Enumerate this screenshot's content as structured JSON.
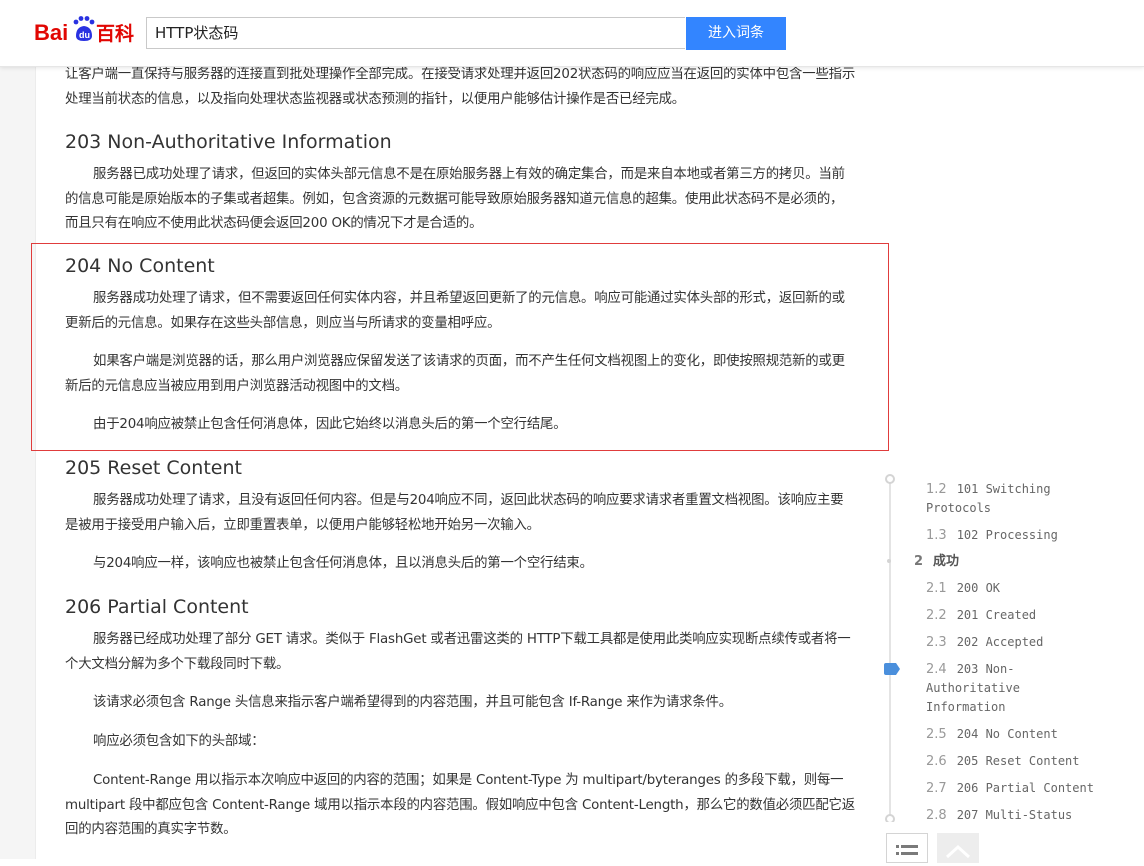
{
  "header": {
    "logo_text": "Bai百科",
    "search_value": "HTTP状态码",
    "search_button": "进入词条"
  },
  "article": {
    "intro_p1": "让客户端一直保持与服务器的连接直到批处理操作全部完成。在接受请求处理并返回202状态码的响应应当在返回的实体中包含一些指示处理当前状态的信息，以及指向处理状态监视器或状态预测的指针，以便用户能够估计操作是否已经完成。",
    "s203_title": "203 Non-Authoritative Information",
    "s203_p1": "服务器已成功处理了请求，但返回的实体头部元信息不是在原始服务器上有效的确定集合，而是来自本地或者第三方的拷贝。当前的信息可能是原始版本的子集或者超集。例如，包含资源的元数据可能导致原始服务器知道元信息的超集。使用此状态码不是必须的，而且只有在响应不使用此状态码便会返回200 OK的情况下才是合适的。",
    "s204_title": "204 No Content",
    "s204_p1": "服务器成功处理了请求，但不需要返回任何实体内容，并且希望返回更新了的元信息。响应可能通过实体头部的形式，返回新的或更新后的元信息。如果存在这些头部信息，则应当与所请求的变量相呼应。",
    "s204_p2": "如果客户端是浏览器的话，那么用户浏览器应保留发送了该请求的页面，而不产生任何文档视图上的变化，即使按照规范新的或更新后的元信息应当被应用到用户浏览器活动视图中的文档。",
    "s204_p3": "由于204响应被禁止包含任何消息体，因此它始终以消息头后的第一个空行结尾。",
    "s205_title": "205 Reset Content",
    "s205_p1": "服务器成功处理了请求，且没有返回任何内容。但是与204响应不同，返回此状态码的响应要求请求者重置文档视图。该响应主要是被用于接受用户输入后，立即重置表单，以便用户能够轻松地开始另一次输入。",
    "s205_p2": "与204响应一样，该响应也被禁止包含任何消息体，且以消息头后的第一个空行结束。",
    "s206_title": "206 Partial Content",
    "s206_p1": "服务器已经成功处理了部分 GET 请求。类似于 FlashGet 或者迅雷这类的 HTTP下载工具都是使用此类响应实现断点续传或者将一个大文档分解为多个下载段同时下载。",
    "s206_p2": "该请求必须包含 Range 头信息来指示客户端希望得到的内容范围，并且可能包含 If-Range 来作为请求条件。",
    "s206_p3": "响应必须包含如下的头部域：",
    "s206_p4": "Content-Range 用以指示本次响应中返回的内容的范围；如果是 Content-Type 为 multipart/byteranges 的多段下载，则每一multipart 段中都应包含 Content-Range 域用以指示本段的内容范围。假如响应中包含 Content-Length，那么它的数值必须匹配它返回的内容范围的真实字节数。"
  },
  "toc": {
    "items": [
      {
        "num": "1.2",
        "text": "101 Switching",
        "text2": "Protocols"
      },
      {
        "num": "1.3",
        "text": "102 Processing"
      },
      {
        "num": "2",
        "text": "成功"
      },
      {
        "num": "2.1",
        "text": "200 OK"
      },
      {
        "num": "2.2",
        "text": "201 Created"
      },
      {
        "num": "2.3",
        "text": "202 Accepted"
      },
      {
        "num": "2.4",
        "text": "203 Non-",
        "text2": "Authoritative",
        "text3": "Information"
      },
      {
        "num": "2.5",
        "text": "204 No Content"
      },
      {
        "num": "2.6",
        "text": "205 Reset Content"
      },
      {
        "num": "2.7",
        "text": "206 Partial Content"
      },
      {
        "num": "2.8",
        "text": "207 Multi-Status"
      }
    ]
  },
  "colors": {
    "accent": "#3385ff",
    "highlight_border": "#e03c3c",
    "toc_marker": "#4a8fdc"
  }
}
